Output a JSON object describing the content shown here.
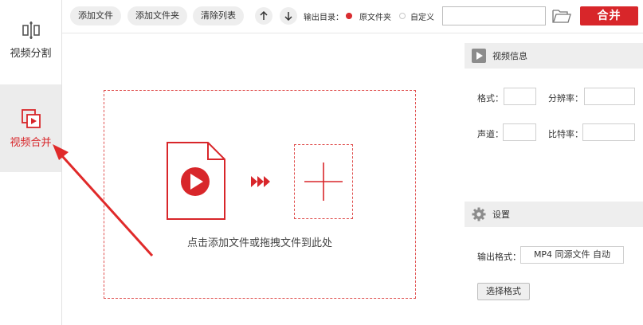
{
  "sidebar": {
    "items": [
      {
        "label": "视频分割",
        "icon": "split-icon",
        "active": false
      },
      {
        "label": "视频合并",
        "icon": "merge-icon",
        "active": true
      }
    ]
  },
  "toolbar": {
    "add_file": "添加文件",
    "add_folder": "添加文件夹",
    "clear_list": "清除列表",
    "move_up_icon": "arrow-up-icon",
    "move_down_icon": "arrow-down-icon",
    "output_dir_label": "输出目录：",
    "option_source_folder": "原文件夹",
    "option_custom": "自定义",
    "selected_option": "原文件夹",
    "path_value": "",
    "merge_button": "合并"
  },
  "dropzone": {
    "hint": "点击添加文件或拖拽文件到此处"
  },
  "video_info": {
    "title": "视频信息",
    "format_label": "格式：",
    "resolution_label": "分辨率：",
    "channel_label": "声道：",
    "bitrate_label": "比特率：",
    "format_value": "",
    "resolution_value": "",
    "channel_value": "",
    "bitrate_value": ""
  },
  "settings": {
    "title": "设置",
    "output_format_label": "输出格式：",
    "output_format_value": "MP4 同源文件 自动",
    "choose_format_button": "选择格式"
  },
  "colors": {
    "accent": "#d8262a",
    "panel_bg": "#eeeeee",
    "active_sidebar_bg": "#ececec"
  }
}
